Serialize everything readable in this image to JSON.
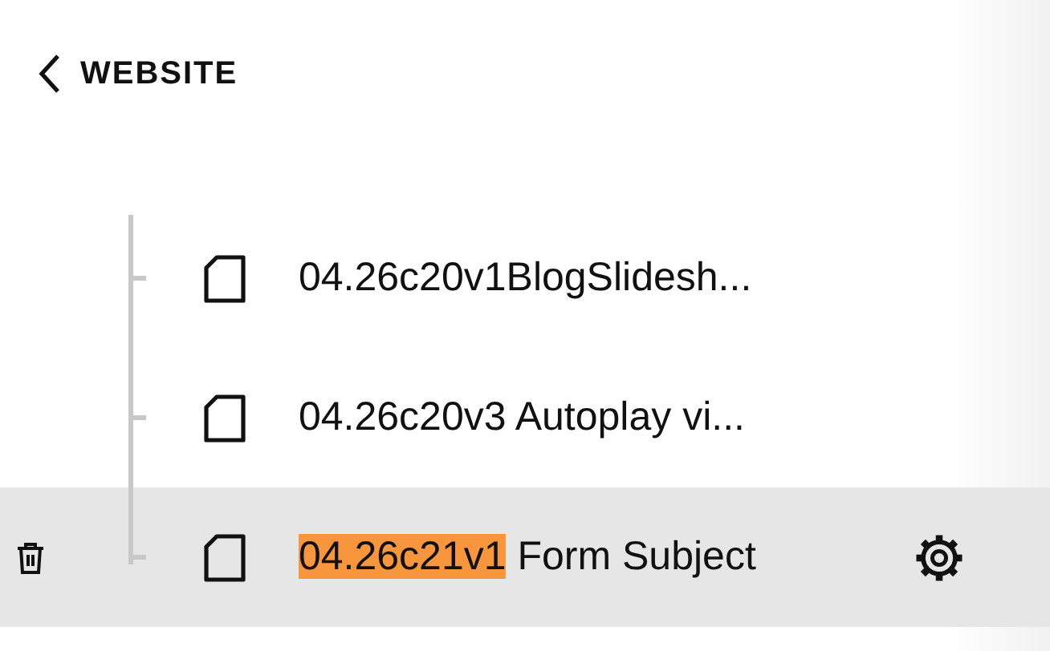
{
  "header": {
    "back_label": "WEBSITE"
  },
  "pages": [
    {
      "label": "04.26c20v1BlogSlidesh...",
      "selected": false
    },
    {
      "label": "04.26c20v3 Autoplay vi...",
      "selected": false
    },
    {
      "highlight": "04.26c21v1",
      "label": "Form Subject",
      "selected": true
    }
  ]
}
